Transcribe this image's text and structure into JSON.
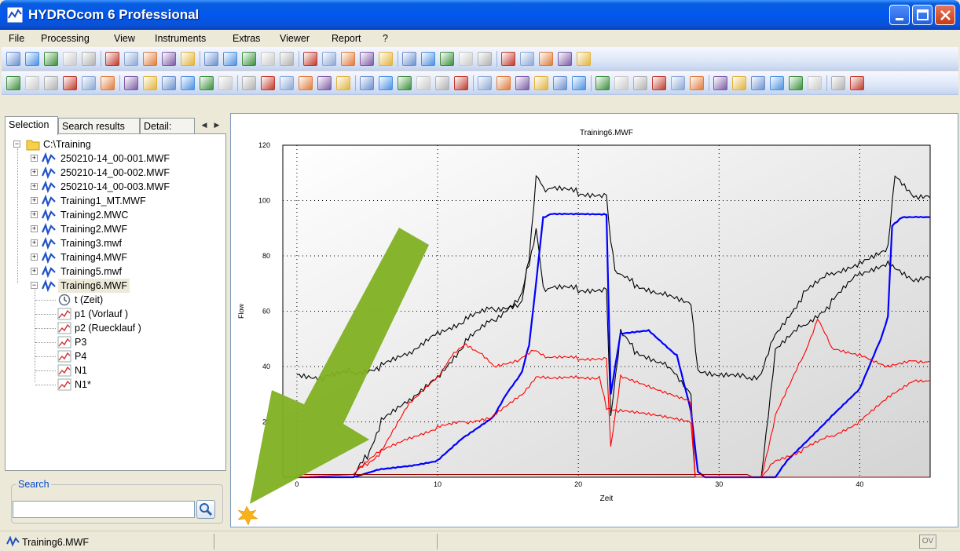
{
  "window": {
    "title": "HYDROcom 6 Professional"
  },
  "menu": [
    "File",
    "Processing",
    "View",
    "Instruments",
    "Extras",
    "Viewer",
    "Report",
    "?"
  ],
  "tabs": {
    "selection": "Selection",
    "search_results": "Search results",
    "details": "Detail:"
  },
  "tree": {
    "root": "C:\\Training",
    "files": [
      "250210-14_00-001.MWF",
      "250210-14_00-002.MWF",
      "250210-14_00-003.MWF",
      "Training1_MT.MWF",
      "Training2.MWC",
      "Training2.MWF",
      "Training3.mwf",
      "Training4.MWF",
      "Training5.mwf",
      "Training6.MWF"
    ],
    "channels": [
      "t (Zeit)",
      "p1 (Vorlauf      )",
      "p2 (Ruecklauf      )",
      "P3",
      "P4",
      "N1",
      "N1*"
    ]
  },
  "search": {
    "label": "Search",
    "value": ""
  },
  "status": {
    "file": "Training6.MWF",
    "ov": "OV"
  },
  "colors": {
    "title_blue": "#0058ee",
    "series_black": "#000000",
    "series_blue": "#0000ff",
    "series_red": "#ff0000",
    "series_darkred": "#990000",
    "arrow_green": "#7fb021"
  },
  "icons": [
    "app-icon",
    "minimize-icon",
    "maximize-icon",
    "close-icon",
    "folder-icon",
    "waveform-file-icon",
    "clock-icon",
    "chart-line-icon",
    "search-icon",
    "star-burst-icon"
  ],
  "chart_data": {
    "type": "line",
    "title": "Training6.MWF",
    "xlabel": "Zeit",
    "ylabel": "Flow",
    "xlim": [
      -1,
      45
    ],
    "ylim": [
      0,
      120
    ],
    "xticks": [
      0,
      10,
      20,
      30,
      40
    ],
    "yticks": [
      20,
      40,
      60,
      80,
      100,
      120
    ],
    "grid": true,
    "series": [
      {
        "color": "#000000",
        "x": [
          0,
          2,
          4,
          6,
          8,
          10,
          12,
          14,
          16,
          16.5,
          17,
          17.5,
          18,
          20,
          22,
          22.3,
          22.6,
          24,
          26,
          28,
          28.5,
          30,
          32,
          33,
          34,
          36,
          38,
          40,
          42,
          42.5,
          44,
          45
        ],
        "y": [
          37,
          36,
          38,
          40,
          45,
          52,
          57,
          61,
          63,
          80,
          108,
          105,
          104,
          103,
          102,
          85,
          75,
          70,
          66,
          63,
          38,
          37,
          36,
          37,
          52,
          66,
          74,
          77,
          83,
          109,
          101,
          101
        ]
      },
      {
        "color": "#000000",
        "x": [
          0,
          4,
          5,
          6,
          8,
          10,
          12,
          14,
          16,
          16.5,
          17,
          17.5,
          18,
          20,
          22,
          22.3,
          23,
          24,
          26,
          27,
          28,
          28.3,
          30,
          32,
          33,
          34,
          36,
          38,
          40,
          42,
          44,
          45
        ],
        "y": [
          0,
          0,
          8,
          20,
          28,
          36,
          49,
          57,
          66,
          78,
          89,
          69,
          68,
          68,
          68,
          22,
          52,
          46,
          41,
          37,
          30,
          0,
          0,
          0,
          0,
          46,
          55,
          63,
          74,
          77,
          71,
          72
        ]
      },
      {
        "color": "#0000ff",
        "x": [
          0,
          4,
          6,
          8,
          10,
          12,
          14,
          15,
          16,
          16.5,
          17,
          17.5,
          18,
          22,
          22.3,
          23,
          25,
          27,
          28,
          28.5,
          29,
          32,
          33,
          34,
          35,
          38,
          40,
          41.5,
          42,
          42.3,
          43,
          44,
          45
        ],
        "y": [
          0,
          0,
          3,
          4,
          6,
          15,
          22,
          31,
          38,
          48,
          70,
          94,
          95,
          95,
          30,
          52,
          53,
          44,
          24,
          2,
          0,
          0,
          0,
          0,
          7,
          22,
          32,
          50,
          58,
          91,
          94,
          94,
          94
        ]
      },
      {
        "color": "#ff0000",
        "x": [
          0,
          4,
          5,
          6,
          8,
          10,
          11,
          12,
          13,
          14,
          16,
          17,
          18,
          20,
          22,
          22.3,
          23,
          26,
          28,
          28.3,
          30,
          32,
          33,
          34,
          36,
          37,
          38,
          40,
          42,
          44,
          45
        ],
        "y": [
          1,
          1,
          5,
          9,
          27,
          36,
          44,
          48,
          45,
          40,
          43,
          46,
          43,
          43,
          43,
          11,
          36,
          31,
          27,
          0,
          0,
          0,
          0,
          22,
          44,
          57,
          47,
          44,
          40,
          42,
          42
        ]
      },
      {
        "color": "#ff0000",
        "x": [
          0,
          4,
          6,
          8,
          10,
          12,
          14,
          16,
          17,
          18,
          20,
          21.5,
          22,
          23,
          28,
          28.3,
          30,
          32,
          33,
          34,
          36,
          38,
          40,
          42,
          44,
          45
        ],
        "y": [
          0,
          1,
          10,
          14,
          18,
          20,
          22,
          30,
          36,
          36,
          36,
          36,
          25,
          24,
          20,
          0,
          0,
          0,
          0,
          6,
          10,
          15,
          20,
          29,
          35,
          35
        ]
      },
      {
        "color": "#990000",
        "x": [
          0,
          4,
          6,
          8,
          10,
          12,
          14,
          16,
          18,
          20,
          22,
          24,
          26,
          28,
          28.4,
          30,
          32,
          32.4,
          34,
          36,
          40,
          45
        ],
        "y": [
          1,
          1,
          1,
          1,
          1,
          1,
          1,
          1,
          1,
          1,
          1,
          1,
          1,
          1,
          1,
          1,
          1,
          0,
          0,
          0,
          0,
          0
        ]
      }
    ]
  }
}
